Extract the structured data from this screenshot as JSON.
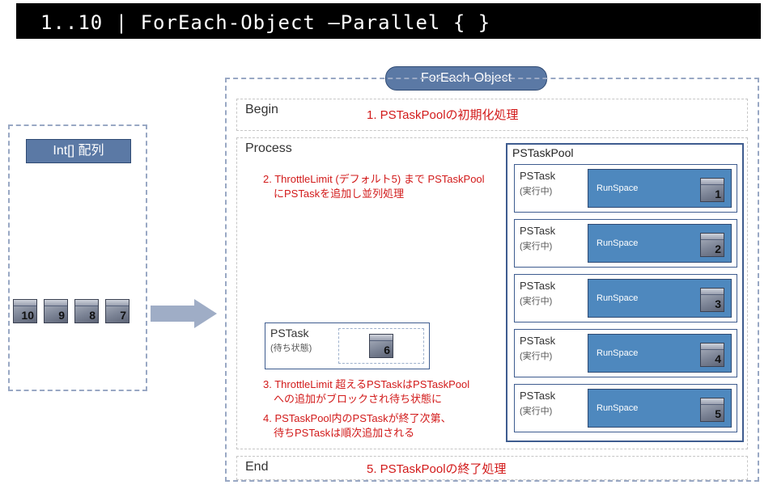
{
  "codebar": "1..10   |   ForEach-Object –Parallel { }",
  "left": {
    "array_label": "Int[] 配列",
    "items": [
      "10",
      "9",
      "8",
      "7"
    ]
  },
  "feo": {
    "label": "ForEach-Object",
    "begin": {
      "title": "Begin",
      "note": "1. PSTaskPoolの初期化処理"
    },
    "process": {
      "title": "Process",
      "note2_l1": "2. ThrottleLimit (デフォルト5) まで PSTaskPool",
      "note2_l2": "　にPSTaskを追加し並列処理",
      "waiting": {
        "label": "PSTask",
        "status": "(待ち状態)",
        "num": "6"
      },
      "note3_l1": "3. ThrottleLimit 超えるPSTaskはPSTaskPool",
      "note3_l2": "　への追加がブロックされ待ち状態に",
      "note4_l1": "4. PSTaskPool内のPSTaskが終了次第、",
      "note4_l2": "　待ちPSTaskは順次追加される",
      "pool": {
        "title": "PSTaskPool",
        "task_label": "PSTask",
        "task_status": "(実行中)",
        "runspace_label": "RunSpace",
        "tasks": [
          "1",
          "2",
          "3",
          "4",
          "5"
        ]
      }
    },
    "end": {
      "title": "End",
      "note": "5. PSTaskPoolの終了処理"
    }
  }
}
